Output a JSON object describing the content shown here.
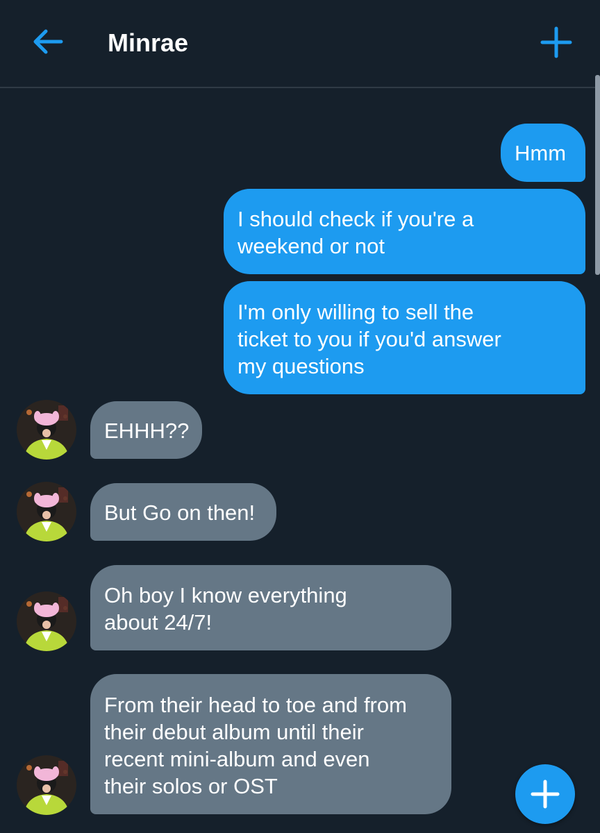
{
  "header": {
    "title": "Minrae",
    "back_icon": "arrow-left-icon",
    "action_icon": "plus-icon"
  },
  "messages": [
    {
      "direction": "sent",
      "text": "Hmm"
    },
    {
      "direction": "sent",
      "text": "I should check if you're a\nweekend or not"
    },
    {
      "direction": "sent",
      "text": "I'm only willing to sell the\nticket to you if you'd answer\nmy questions"
    },
    {
      "direction": "received",
      "text": "EHHH??"
    },
    {
      "direction": "received",
      "text": "But Go on then!"
    },
    {
      "direction": "received",
      "text": "Oh boy I know everything\nabout 24/7!"
    },
    {
      "direction": "received",
      "text": "From their head to toe and from\ntheir debut album until their\nrecent mini-album and even\ntheir solos or OST"
    }
  ],
  "fab": {
    "icon": "plus-icon"
  },
  "colors": {
    "background": "#15202b",
    "accent": "#1d9bf0",
    "received_bubble": "#657786",
    "divider": "#2f3a45"
  }
}
